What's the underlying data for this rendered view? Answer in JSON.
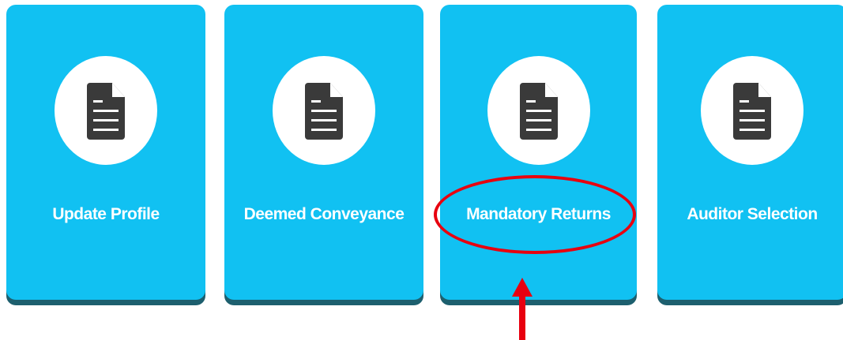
{
  "tiles": [
    {
      "label": "Update Profile",
      "icon": "document-icon"
    },
    {
      "label": "Deemed Conveyance",
      "icon": "document-icon"
    },
    {
      "label": "Mandatory Returns",
      "icon": "document-icon"
    },
    {
      "label": "Auditor Selection",
      "icon": "document-icon"
    }
  ],
  "colors": {
    "tile": "#11c1f2",
    "tile_shadow": "#1d5f6e",
    "icon": "#3a3a3a",
    "annotation": "#e8000f"
  },
  "annotation": {
    "highlighted_tile": "Mandatory Returns",
    "shapes": [
      "ellipse",
      "arrow"
    ]
  }
}
